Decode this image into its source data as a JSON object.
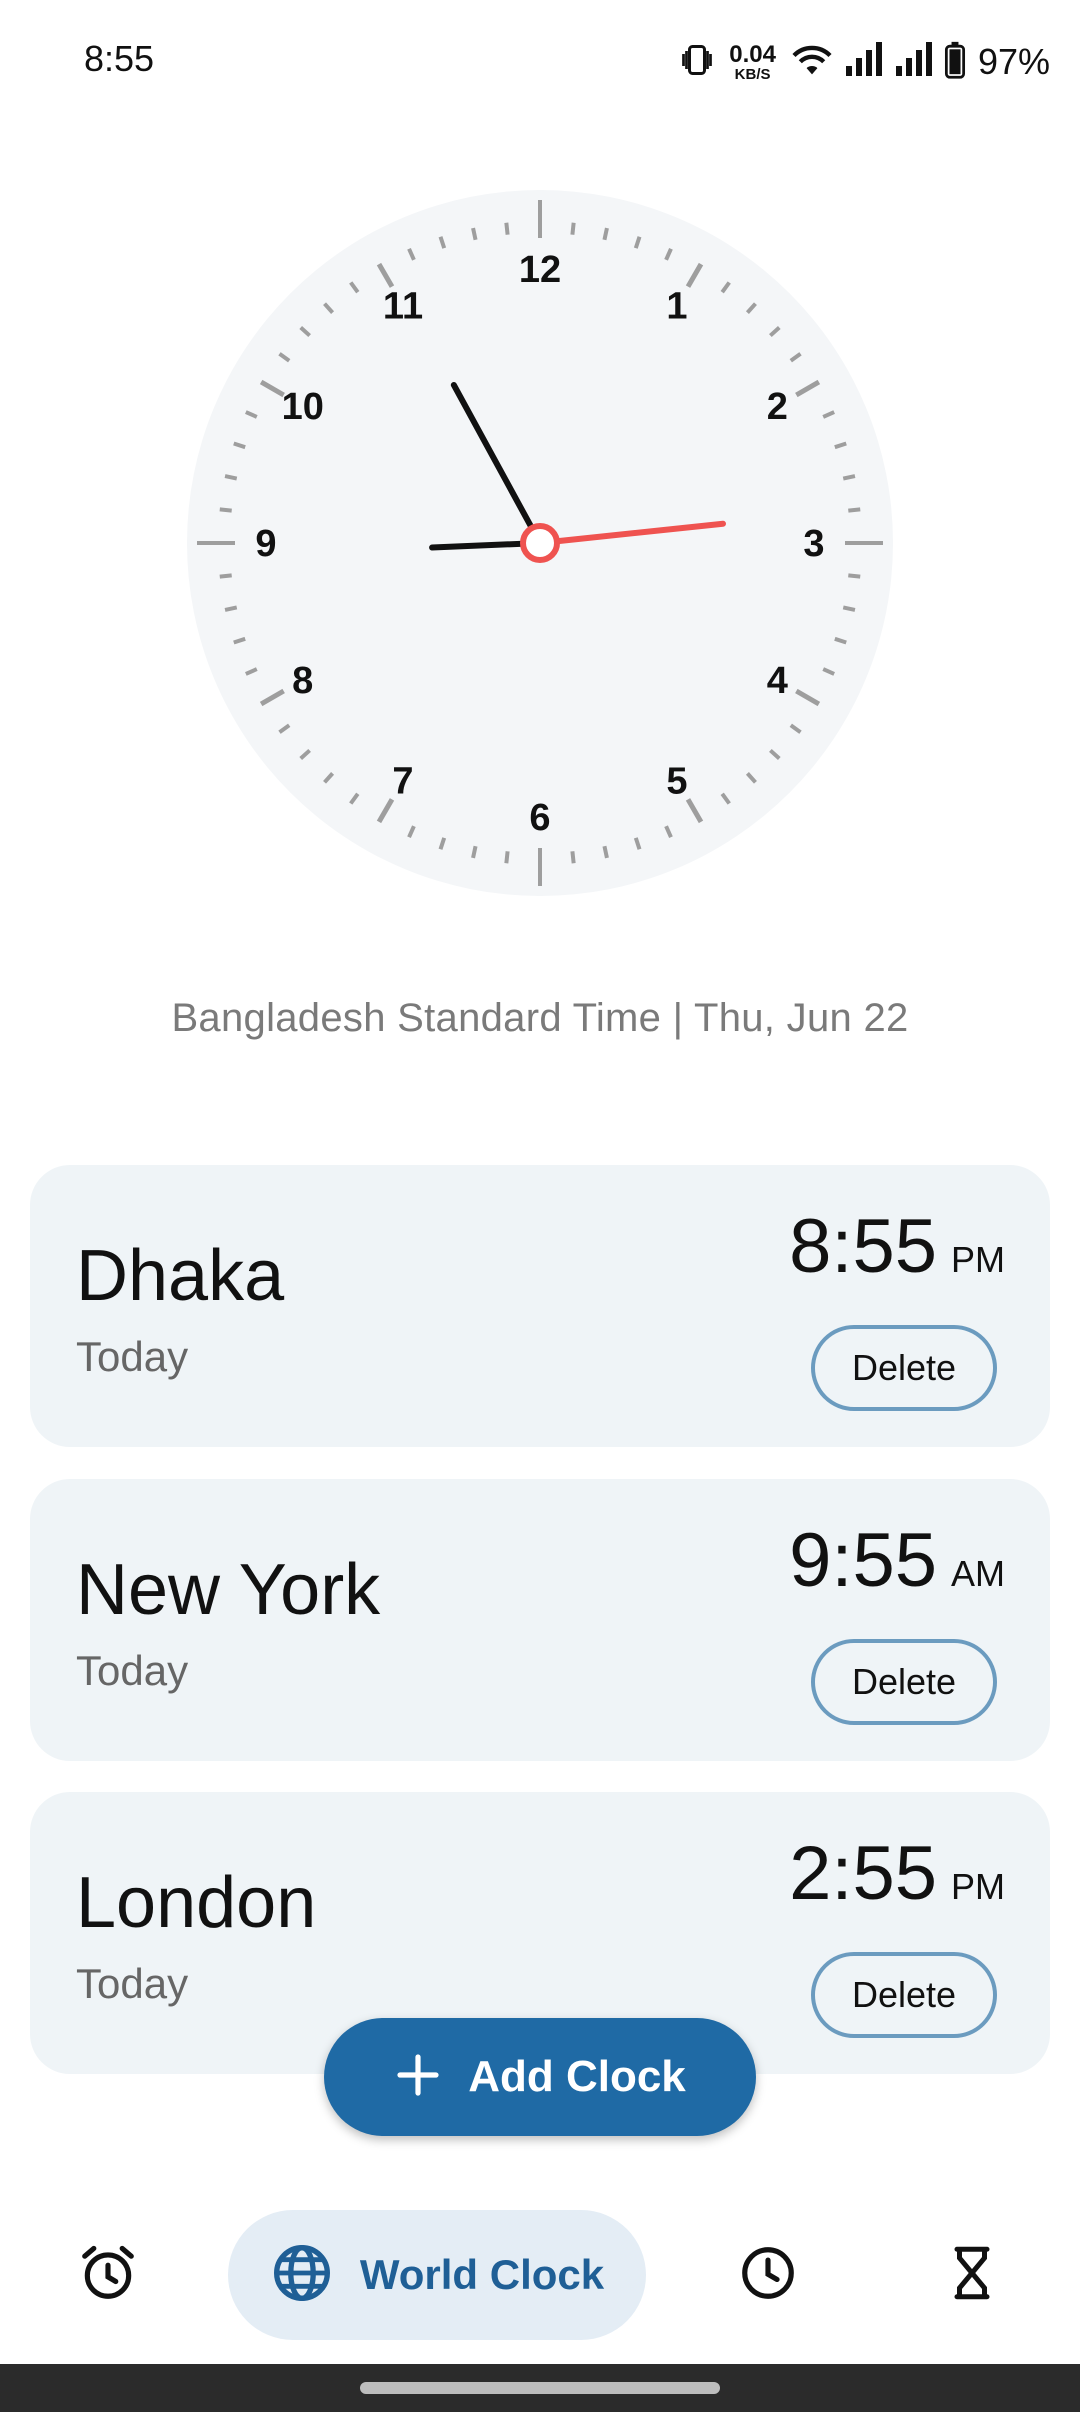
{
  "status_bar": {
    "time": "8:55",
    "net_speed_value": "0.04",
    "net_speed_unit": "KB/S",
    "battery_percent": "97%",
    "icons": [
      "vibrate-icon",
      "wifi-icon",
      "signal-icon",
      "signal-icon",
      "battery-icon"
    ]
  },
  "analog_clock": {
    "numerals": [
      "12",
      "1",
      "2",
      "3",
      "4",
      "5",
      "6",
      "7",
      "8",
      "9",
      "10",
      "11"
    ],
    "hour": 8,
    "minute": 55,
    "second": 14,
    "colors": {
      "face": "#f4f6f8",
      "hand": "#111111",
      "second_hand": "#ef5350",
      "tick": "#9e9e9e"
    }
  },
  "timezone_caption": "Bangladesh Standard Time | Thu, Jun 22",
  "clocks": [
    {
      "city": "Dhaka",
      "day": "Today",
      "time": "8:55",
      "ampm": "PM",
      "delete_label": "Delete"
    },
    {
      "city": "New York",
      "day": "Today",
      "time": "9:55",
      "ampm": "AM",
      "delete_label": "Delete"
    },
    {
      "city": "London",
      "day": "Today",
      "time": "2:55",
      "ampm": "PM",
      "delete_label": "Delete"
    }
  ],
  "fab": {
    "label": "Add Clock",
    "icon": "plus-icon",
    "color": "#1f6aa5"
  },
  "bottom_nav": {
    "items": [
      {
        "icon": "alarm-icon",
        "label": ""
      },
      {
        "icon": "globe-icon",
        "label": "World Clock",
        "active": true
      },
      {
        "icon": "clock-icon",
        "label": ""
      },
      {
        "icon": "hourglass-icon",
        "label": ""
      }
    ],
    "active_color": "#1f5f96"
  }
}
